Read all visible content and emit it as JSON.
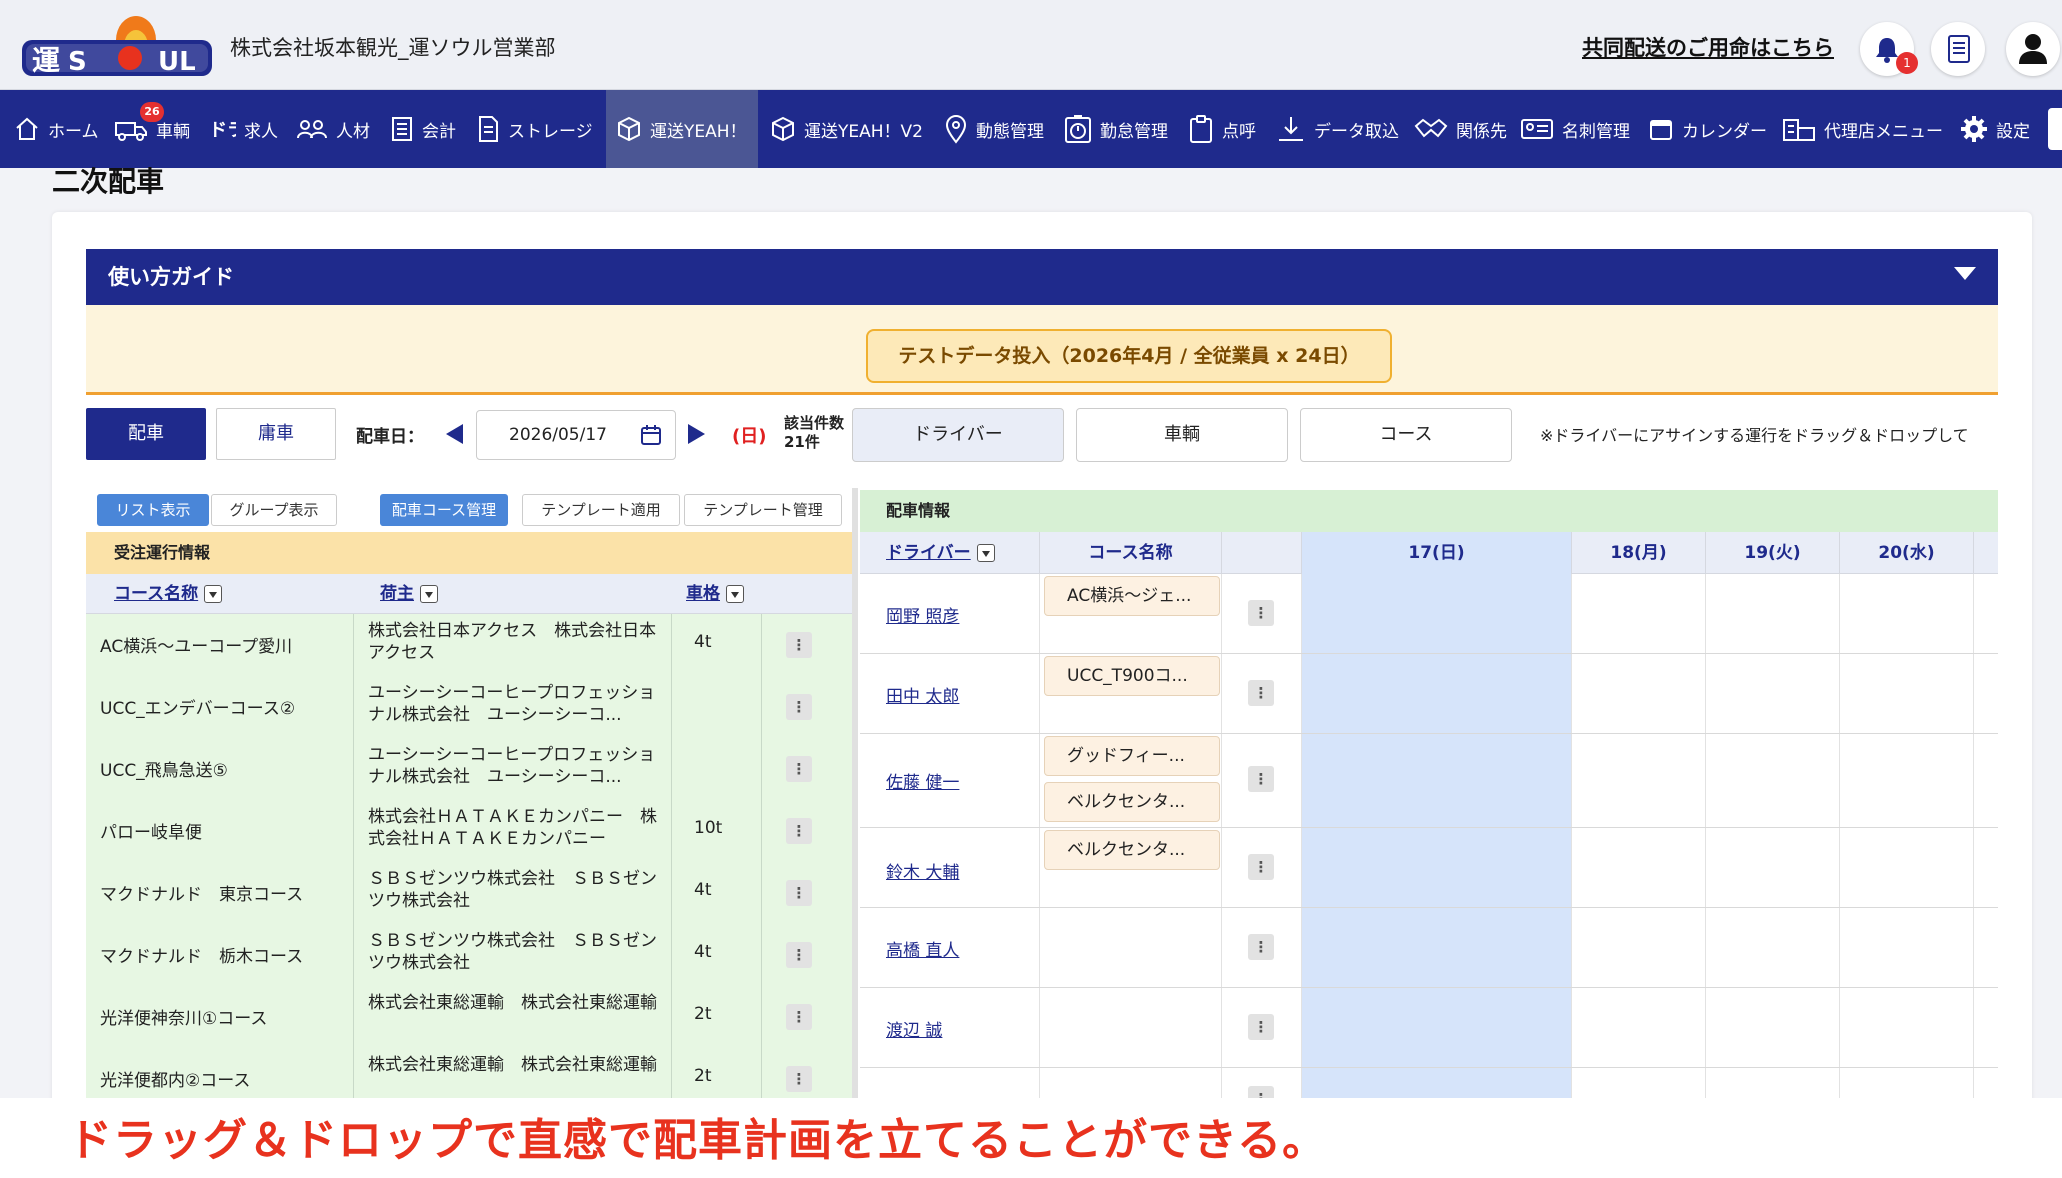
{
  "header": {
    "company": "株式会社坂本観光_運ソウル営業部",
    "shared_delivery_link": "共同配送のご用命はこちら",
    "notification_count": "1"
  },
  "nav": {
    "items": [
      {
        "label": "ホーム",
        "icon": "home-icon"
      },
      {
        "label": "車輌",
        "icon": "truck-icon",
        "badge": "26"
      },
      {
        "label": "求人",
        "icon": "dora-icon"
      },
      {
        "label": "人材",
        "icon": "people-icon"
      },
      {
        "label": "会計",
        "icon": "ledger-icon"
      },
      {
        "label": "ストレージ",
        "icon": "document-icon"
      },
      {
        "label": "運送YEAH！",
        "icon": "box-icon",
        "active": true
      },
      {
        "label": "運送YEAH！V2",
        "icon": "box-icon"
      },
      {
        "label": "動態管理",
        "icon": "map-pin-icon"
      },
      {
        "label": "勤怠管理",
        "icon": "stopwatch-icon"
      },
      {
        "label": "点呼",
        "icon": "clipboard-icon"
      },
      {
        "label": "データ取込",
        "icon": "download-icon"
      },
      {
        "label": "関係先",
        "icon": "handshake-icon"
      },
      {
        "label": "名刺管理",
        "icon": "id-card-icon"
      },
      {
        "label": "カレンダー",
        "icon": "calendar-icon"
      },
      {
        "label": "代理店メニュー",
        "icon": "building-icon"
      },
      {
        "label": "設定",
        "icon": "gear-icon"
      }
    ]
  },
  "page": {
    "title": "二次配車",
    "guide_label": "使い方ガイド",
    "test_data_button": "テストデータ投入（2026年4月 / 全従業員 x 24日）"
  },
  "controls": {
    "dispatch_tab": "配車",
    "charter_tab": "庸車",
    "date_label": "配車日：",
    "date_value": "2026/05/17",
    "day_of_week": "(日)",
    "count_label": "該当件数",
    "count_value": "21件",
    "view_tabs": [
      "ドライバー",
      "車輌",
      "コース"
    ],
    "hint": "※ドライバーにアサインする運行をドラッグ＆ドロップして"
  },
  "left": {
    "toolbar": [
      "リスト表示",
      "グループ表示",
      "配車コース管理",
      "テンプレート適用",
      "テンプレート管理"
    ],
    "section_title": "受注運行情報",
    "columns": [
      "コース名称",
      "荷主",
      "車格"
    ],
    "rows": [
      {
        "course": "AC横浜～ユーコープ愛川",
        "shipper": "株式会社日本アクセス　株式会社日本アクセス",
        "size": "4t"
      },
      {
        "course": "UCC_エンデバーコース②",
        "shipper": "ユーシーシーコーヒープロフェッショナル株式会社　ユーシーシーコ...",
        "size": ""
      },
      {
        "course": "UCC_飛鳥急送⑤",
        "shipper": "ユーシーシーコーヒープロフェッショナル株式会社　ユーシーシーコ...",
        "size": ""
      },
      {
        "course": "パロー岐阜便",
        "shipper": "株式会社ＨＡＴＡＫＥカンパニー　株式会社ＨＡＴＡＫＥカンパニー",
        "size": "10t"
      },
      {
        "course": "マクドナルド　東京コース",
        "shipper": "ＳＢＳゼンツウ株式会社　ＳＢＳゼンツウ株式会社",
        "size": "4t"
      },
      {
        "course": "マクドナルド　栃木コース",
        "shipper": "ＳＢＳゼンツウ株式会社　ＳＢＳゼンツウ株式会社",
        "size": "4t"
      },
      {
        "course": "光洋便神奈川①コース",
        "shipper": "株式会社東総運輸　株式会社東総運輸",
        "size": "2t"
      },
      {
        "course": "光洋便都内②コース",
        "shipper": "株式会社東総運輸　株式会社東総運輸",
        "size": "2t"
      }
    ]
  },
  "right": {
    "section_title": "配車情報",
    "columns": {
      "driver": "ドライバー",
      "course": "コース名称",
      "days": [
        "17(日)",
        "18(月)",
        "19(火)",
        "20(水)"
      ]
    },
    "rows": [
      {
        "driver": "岡野 照彦",
        "courses": [
          "AC横浜～ジェ..."
        ]
      },
      {
        "driver": "田中 太郎",
        "courses": [
          "UCC_T900コ..."
        ]
      },
      {
        "driver": "佐藤 健一",
        "courses": [
          "グッドフィー...",
          "ベルクセンタ..."
        ]
      },
      {
        "driver": "鈴木 大輔",
        "courses": [
          "ベルクセンタ..."
        ]
      },
      {
        "driver": "高橋 直人",
        "courses": []
      },
      {
        "driver": "渡辺 誠",
        "courses": []
      },
      {
        "driver": "",
        "courses": []
      }
    ]
  },
  "caption": "ドラッグ＆ドロップで直感で配車計画を立てることができる。",
  "colors": {
    "navy": "#1f2a8c",
    "accent_red": "#e8321e",
    "today": "#d6e4fa",
    "order_row": "#e7f7e3"
  }
}
